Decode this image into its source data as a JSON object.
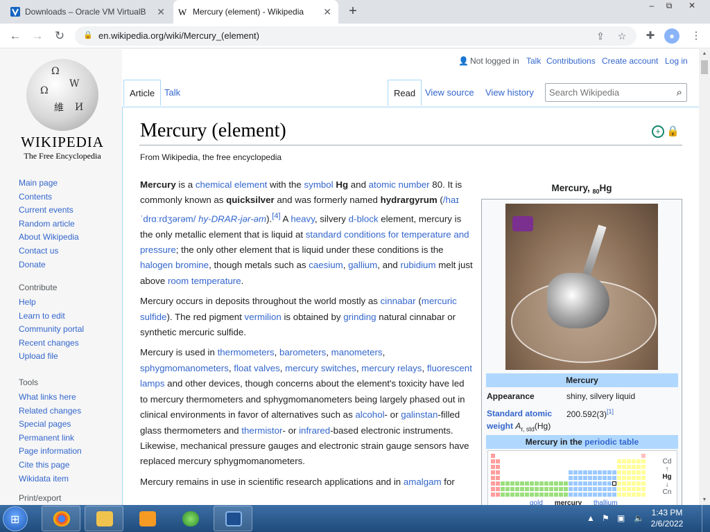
{
  "browser": {
    "tabs": [
      {
        "title": "Downloads – Oracle VM VirtualB",
        "active": false
      },
      {
        "title": "Mercury (element) - Wikipedia",
        "active": true
      }
    ],
    "new_tab": "+",
    "window_controls": [
      "–",
      "⧉",
      "✕"
    ],
    "url": "en.wikipedia.org/wiki/Mercury_(element)"
  },
  "wiki": {
    "wordmark": "WIKIPEDIA",
    "tagline": "The Free Encyclopedia",
    "personal_tools": [
      "Not logged in",
      "Talk",
      "Contributions",
      "Create account",
      "Log in"
    ],
    "namespace_tabs": [
      "Article",
      "Talk"
    ],
    "view_tabs": [
      "Read",
      "View source",
      "View history"
    ],
    "search_placeholder": "Search Wikipedia",
    "sidebar": {
      "main": [
        "Main page",
        "Contents",
        "Current events",
        "Random article",
        "About Wikipedia",
        "Contact us",
        "Donate"
      ],
      "contribute_heading": "Contribute",
      "contribute": [
        "Help",
        "Learn to edit",
        "Community portal",
        "Recent changes",
        "Upload file"
      ],
      "tools_heading": "Tools",
      "tools": [
        "What links here",
        "Related changes",
        "Special pages",
        "Permanent link",
        "Page information",
        "Cite this page",
        "Wikidata item"
      ],
      "print_heading": "Print/export"
    },
    "title": "Mercury (element)",
    "from": "From Wikipedia, the free encyclopedia",
    "infobox": {
      "title_main": "Mercury, ",
      "title_sub": "80",
      "title_sym": "Hg",
      "header1": "Mercury",
      "appearance_label": "Appearance",
      "appearance_value": "shiny, silvery liquid",
      "weight_label_1": "Standard atomic",
      "weight_label_2": "weight ",
      "weight_label_a": "A",
      "weight_label_sub": "r, std",
      "weight_label_end": "(Hg)",
      "weight_value": "200.592(3)",
      "weight_ref": "[1]",
      "header2_prefix": "Mercury in the ",
      "header2_link": "periodic table",
      "pt_above": "Cd",
      "pt_sym": "Hg",
      "pt_below": "Cn",
      "pt_neighbors": [
        "gold",
        "mercury",
        "thallium"
      ]
    }
  },
  "taskbar": {
    "time": "1:43 PM",
    "date": "2/6/2022"
  }
}
